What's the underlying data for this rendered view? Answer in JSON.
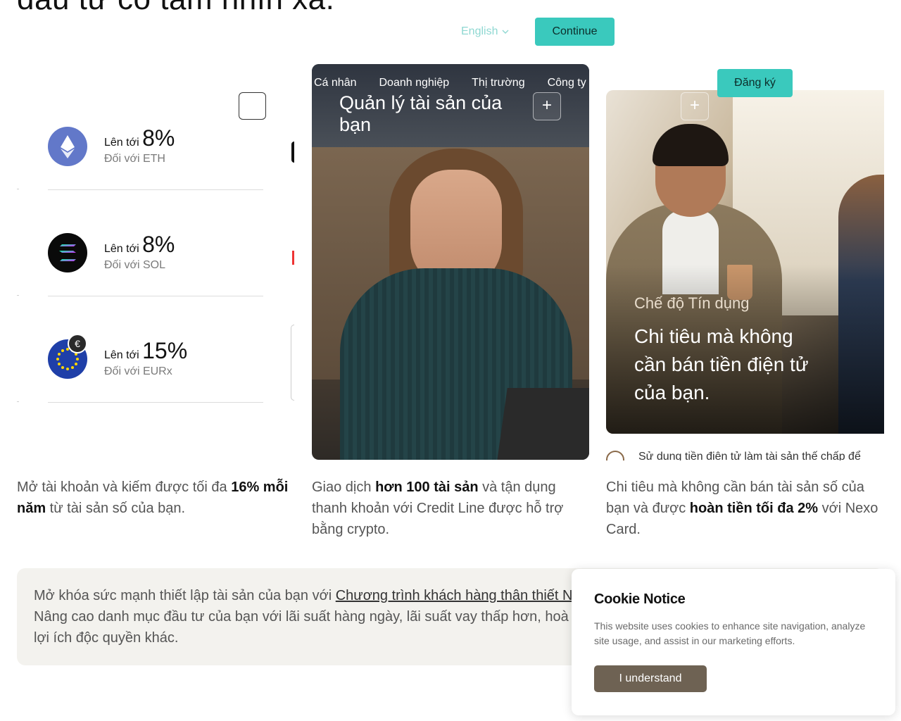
{
  "header": {
    "heading_partial": "đầu tư có tầm nhìn xa.",
    "language": "English",
    "continue_label": "Continue"
  },
  "rates": [
    {
      "up_to": "Lên tới",
      "rate": "8%",
      "asset": "Đối với ETH",
      "coin": "ethereum-icon"
    },
    {
      "up_to": "Lên tới",
      "rate": "8%",
      "asset": "Đối với SOL",
      "coin": "solana-icon"
    },
    {
      "up_to": "Lên tới",
      "rate": "15%",
      "asset": "Đối với EURx",
      "coin": "eu-flag-icon",
      "badge": "€"
    }
  ],
  "wealth_card": {
    "nav": [
      "Cá nhân",
      "Doanh nghiệp",
      "Thị trường",
      "Công ty"
    ],
    "title": "Quản lý tài sản của bạn",
    "plus": "+"
  },
  "credit_card": {
    "signup_label": "Đăng ký",
    "plus": "+",
    "mode": "Chế độ Tín dụng",
    "headline": "Chi tiêu mà không cần bán tiền điện tử của bạn.",
    "sub": "Sử dụng tiền điện tử làm tài sản thế chấp để"
  },
  "descriptions": {
    "d1_pre": "Mở tài khoản và kiếm được tối đa ",
    "d1_bold": "16% mỗi năm",
    "d1_post": " từ tài sản số của bạn.",
    "d2_pre": "Giao dịch ",
    "d2_bold": "hơn 100 tài sản",
    "d2_post": " và tận dụng thanh khoản với Credit Line được hỗ trợ bằng crypto.",
    "d3_pre": "Chi tiêu mà không cần bán tài sản số của bạn và được ",
    "d3_bold": "hoàn tiền tối đa 2%",
    "d3_post": " với Nexo Card."
  },
  "loyalty": {
    "line1_pre": "Mở khóa sức mạnh thiết lập tài sản của bạn với ",
    "line1_link": "Chương trình khách hàng thân thiết N",
    "line2": "Nâng cao danh mục đầu tư của bạn với lãi suất hàng ngày, lãi suất vay thấp hơn, hoà",
    "line3": "lợi ích độc quyền khác."
  },
  "cookie": {
    "title": "Cookie Notice",
    "body": "This website uses cookies to enhance site navigation, analyze site usage, and assist in our marketing efforts.",
    "button": "I understand"
  },
  "colors": {
    "accent": "#3ac9bd",
    "cookie_button": "#6e6253",
    "banner_bg": "#f3f2ee"
  }
}
